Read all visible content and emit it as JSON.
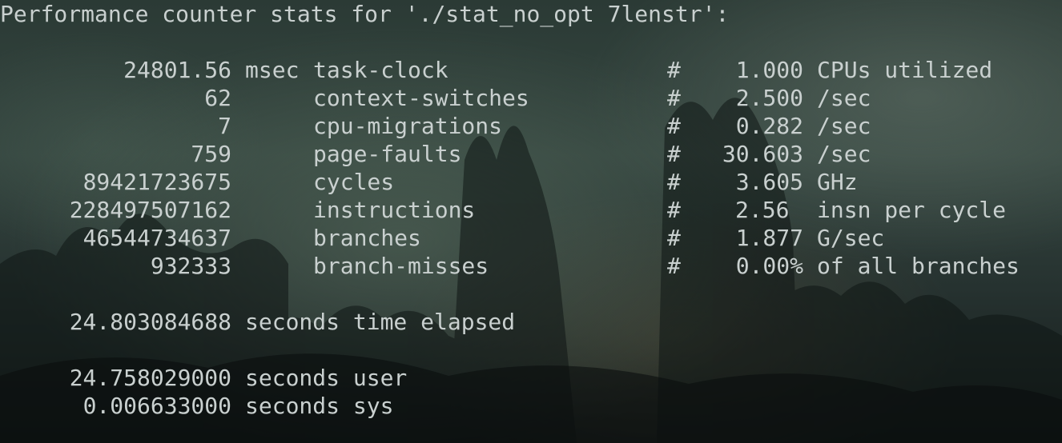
{
  "terminal": {
    "header": "Performance counter stats for './stat_no_opt 7lenstr':",
    "counters": [
      {
        "value": "24801.56",
        "unit": "msec",
        "event": "task-clock",
        "hash": "#",
        "metric": "1.000",
        "metric_unit": "CPUs utilized"
      },
      {
        "value": "62",
        "unit": "",
        "event": "context-switches",
        "hash": "#",
        "metric": "2.500",
        "metric_unit": "/sec"
      },
      {
        "value": "7",
        "unit": "",
        "event": "cpu-migrations",
        "hash": "#",
        "metric": "0.282",
        "metric_unit": "/sec"
      },
      {
        "value": "759",
        "unit": "",
        "event": "page-faults",
        "hash": "#",
        "metric": "30.603",
        "metric_unit": "/sec"
      },
      {
        "value": "89421723675",
        "unit": "",
        "event": "cycles",
        "hash": "#",
        "metric": "3.605",
        "metric_unit": "GHz"
      },
      {
        "value": "228497507162",
        "unit": "",
        "event": "instructions",
        "hash": "#",
        "metric": "2.56",
        "metric_unit": "insn per cycle"
      },
      {
        "value": "46544734637",
        "unit": "",
        "event": "branches",
        "hash": "#",
        "metric": "1.877",
        "metric_unit": "G/sec"
      },
      {
        "value": "932333",
        "unit": "",
        "event": "branch-misses",
        "hash": "#",
        "metric": "0.00%",
        "metric_unit": "of all branches"
      }
    ],
    "elapsed": {
      "value": "24.803084688",
      "label": "seconds time elapsed"
    },
    "user": {
      "value": "24.758029000",
      "label": "seconds user"
    },
    "sys": {
      "value": "0.006633000",
      "label": "seconds sys"
    }
  }
}
